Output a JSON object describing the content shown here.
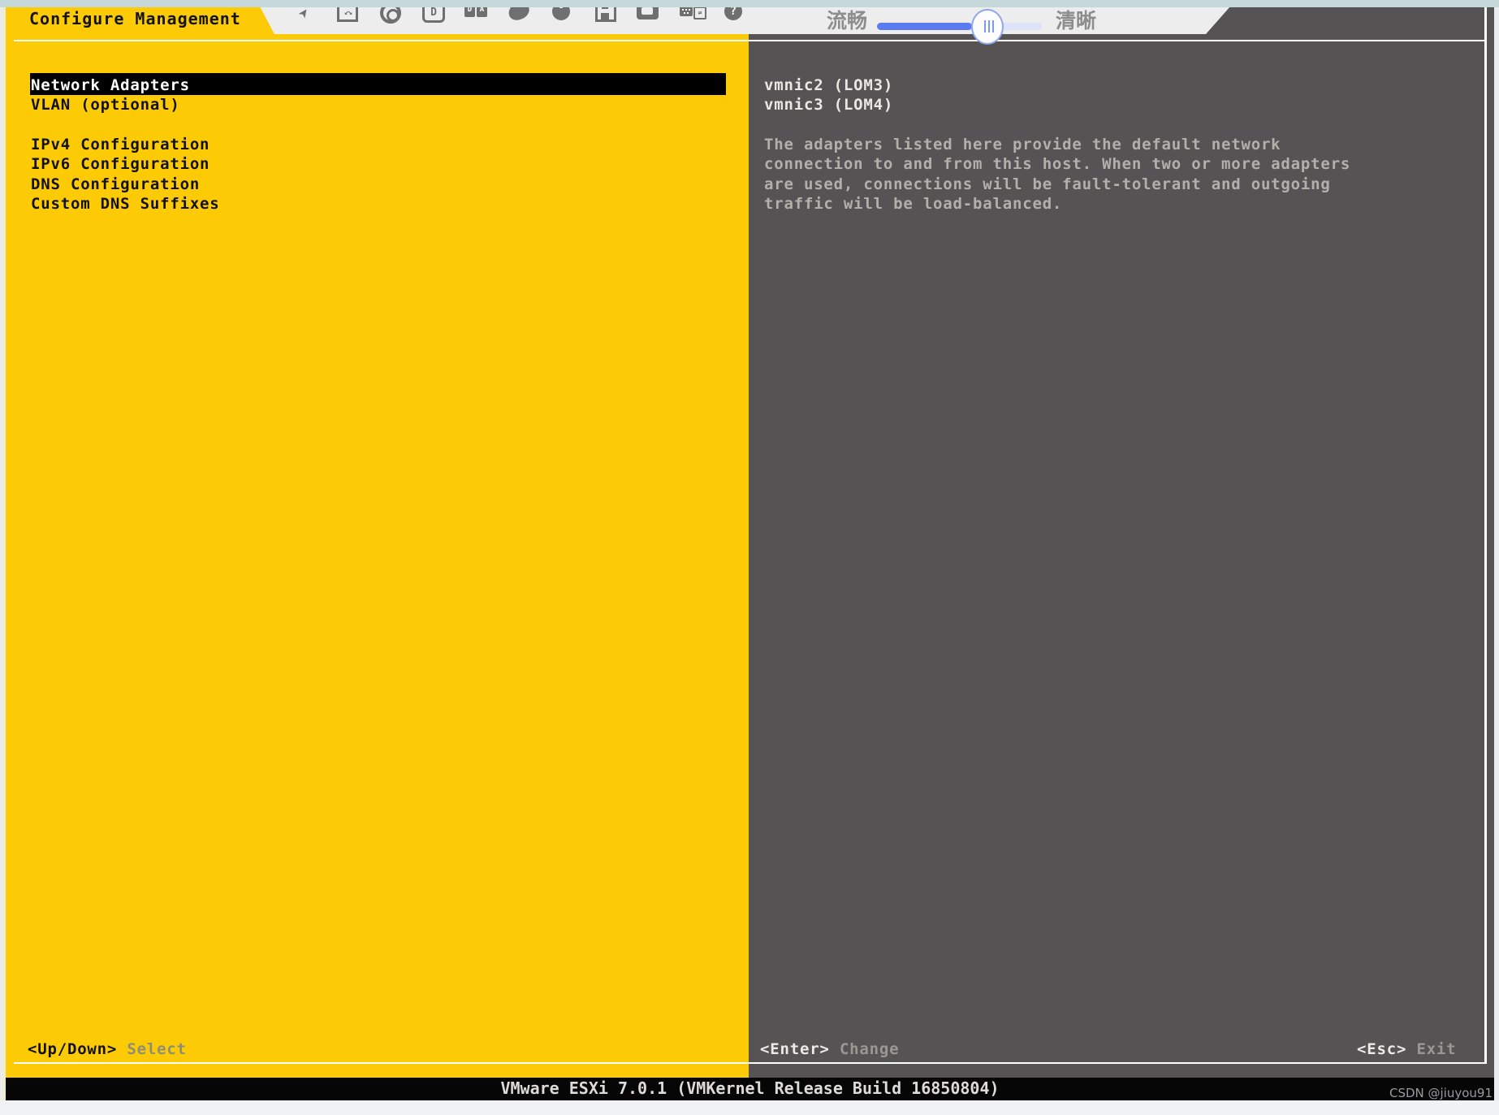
{
  "console_toolbar": {
    "icons": [
      "pin-icon",
      "fullscreen-icon",
      "record-icon",
      "display-d-icon",
      "keyboard-da-icon",
      "mouse-icon",
      "power-icon",
      "save-icon",
      "monitor-icon",
      "macro-icon",
      "help-icon"
    ],
    "icon_glyphs": {
      "fullscreen": "↙↘",
      "display_d": "D",
      "kbd_d": "D",
      "kbd_a": "A",
      "macro_swap": "⇄",
      "help": "?",
      "pin": "➤"
    },
    "quality_slider": {
      "left_label": "流畅",
      "right_label": "清晰",
      "value_percent": 57
    }
  },
  "dcui": {
    "title": "Configure Management",
    "menu_items": [
      {
        "label": "Network Adapters",
        "selected": true
      },
      {
        "label": "VLAN (optional)",
        "selected": false
      },
      {
        "label": "IPv4 Configuration",
        "selected": false
      },
      {
        "label": "IPv6 Configuration",
        "selected": false
      },
      {
        "label": "DNS Configuration",
        "selected": false
      },
      {
        "label": "Custom DNS Suffixes",
        "selected": false
      }
    ],
    "details": {
      "adapters": [
        "vmnic2 (LOM3)",
        "vmnic3 (LOM4)"
      ],
      "description_lines": [
        "The adapters listed here provide the default network",
        "connection to and from this host. When two or more adapters",
        "are used, connections will be fault-tolerant and outgoing",
        "traffic will be load-balanced."
      ]
    },
    "hints": {
      "select": {
        "key": "<Up/Down>",
        "action": "Select"
      },
      "change": {
        "key": "<Enter>",
        "action": "Change"
      },
      "exit": {
        "key": "<Esc>",
        "action": "Exit"
      }
    },
    "version_text": "VMware ESXi 7.0.1 (VMKernel Release Build 16850804)"
  },
  "watermark": "CSDN @jiuyou91",
  "colors": {
    "dcui_yellow": "#FCCB06",
    "dcui_gray": "#565355",
    "highlight_black": "#000000",
    "toolbar_bg": "#EDEDED",
    "top_strip": "#C6D7D9",
    "slider_blue": "#5B7CF0",
    "slider_track": "#DCE3F9"
  }
}
